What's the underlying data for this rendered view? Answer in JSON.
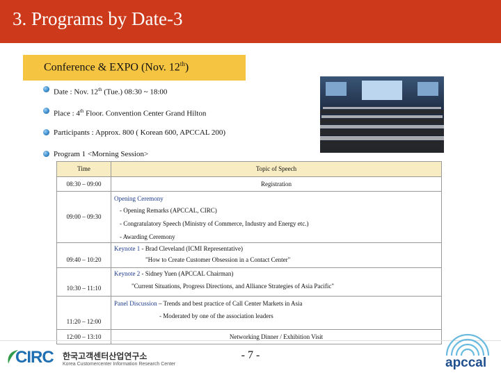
{
  "header": {
    "title": "3. Programs by Date-3"
  },
  "conference": {
    "title_main": "Conference & EXPO (Nov. 12",
    "title_sup": "th",
    "title_end": ")"
  },
  "details": [
    {
      "pre": "Date :  Nov. 12",
      "sup": "th",
      "post": " (Tue.) 08:30 ~ 18:00"
    },
    {
      "pre": "Place : 4",
      "sup": "th",
      "post": " Floor. Convention Center Grand Hilton"
    },
    {
      "pre": "Participants : Approx. 800 ( Korean 600, APCCAL  200)",
      "sup": "",
      "post": ""
    },
    {
      "pre": "Program  1 <Morning Session>",
      "sup": "",
      "post": ""
    }
  ],
  "table": {
    "headers": {
      "time": "Time",
      "topic": "Topic of Speech"
    },
    "rows": [
      {
        "time": "08:30 – 09:00",
        "lines": [
          "Registration"
        ]
      },
      {
        "time": "09:00 – 09:30",
        "keyword": "Opening Ceremony",
        "lines": [
          "- Opening Remarks (APCCAL, CIRC)",
          "- Congratulatory Speech (Ministry of Commerce, Industry and Energy etc.)",
          "- Awarding Ceremony"
        ]
      },
      {
        "time": "09:40 – 10:20",
        "keyword": "Keynote 1",
        "speaker": "  - Brad Cleveland (ICMI Representative)",
        "lines": [
          "\"How to Create Customer Obsession in a Contact Center\""
        ]
      },
      {
        "time": "10:30 – 11:10",
        "keyword": "Keynote 2",
        "speaker": "  - Sidney Yuen (APCCAL Chairman)",
        "lines": [
          "\"Current Situations, Progress Directions, and Alliance Strategies of Asia Pacific\""
        ]
      },
      {
        "time": "11:20 – 12:00",
        "keyword": "Panel Discussion",
        "speaker": " – Trends and best practice of Call Center Markets in Asia",
        "lines": [
          "- Moderated by one of the association leaders"
        ]
      },
      {
        "time": "12:00 – 13:10",
        "lines": [
          "Networking Dinner / Exhibition Visit"
        ]
      }
    ]
  },
  "footer": {
    "page_number": "- 7 -",
    "circ_logo": {
      "word": "CIRC",
      "korean": "한국고객센터산업연구소",
      "english": "Korea Customercenter Information Research Center"
    },
    "apccal_logo": {
      "word": "apccal"
    }
  },
  "colors": {
    "title_bar": "#cc3a1b",
    "conference_box": "#f5c542",
    "table_header": "#f8ecc2",
    "keyword": "#1d3a8a",
    "bullet": "#3a8ccb"
  }
}
